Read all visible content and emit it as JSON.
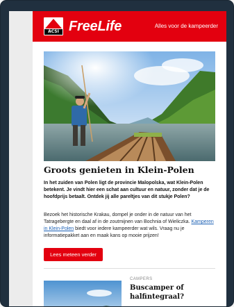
{
  "header": {
    "logo_text": "ACSI",
    "brand": "FreeLife",
    "tagline": "Alles voor de kampeerder"
  },
  "article": {
    "image_icon": "river-raft-photo",
    "title": "Groots genieten in Klein-Polen",
    "intro": "In het zuiden van Polen ligt de provincie Malopolska, wat Klein-Polen betekent. Je vindt hier een schat aan cultuur en natuur, zonder dat je de hoofdprijs betaalt. Ontdek jij alle pareltjes van dit stukje Polen?",
    "body_part1": "Bezoek het historische Krakau, dompel je onder in de natuur van het Tatragebergte en daal af in de zoutmijnen van Bochnia of Wieliczka. ",
    "link_text": "Kamperen in Klein-Polen",
    "body_part2": " biedt voor iedere kampeerder wat wils. Vraag nu je informatiepakket aan en maak kans op mooie prijzen!",
    "cta_label": "Lees meteen verder"
  },
  "next_article": {
    "image_icon": "campervan-landscape-photo",
    "category": "CAMPERS",
    "title": "Buscamper of halfintegraal?"
  },
  "colors": {
    "brand_red": "#e3000f",
    "frame": "#20303f",
    "link": "#1a5fb4"
  }
}
